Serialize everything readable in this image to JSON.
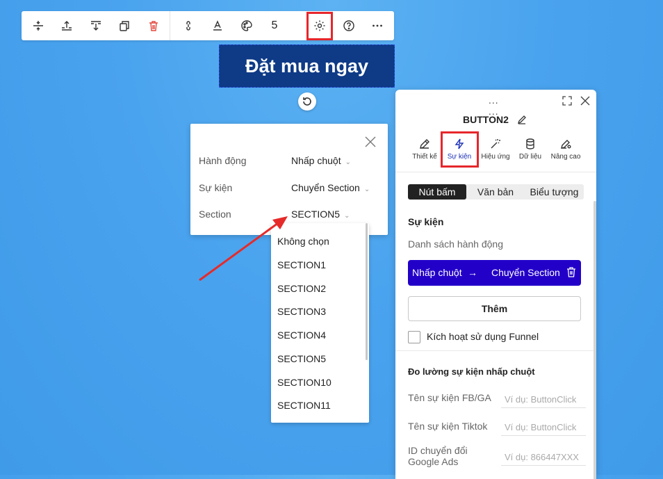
{
  "toolbar": {
    "buttons": [
      {
        "name": "align-center-icon"
      },
      {
        "name": "move-up-icon"
      },
      {
        "name": "move-down-icon"
      },
      {
        "name": "duplicate-icon"
      },
      {
        "name": "delete-icon"
      },
      {
        "name": "link-icon"
      },
      {
        "name": "text-style-icon"
      },
      {
        "name": "palette-icon"
      },
      {
        "name": "settings-icon"
      },
      {
        "name": "help-icon"
      },
      {
        "name": "more-icon"
      }
    ],
    "layer_count": "5",
    "colors": {
      "delete": "#e0463c",
      "highlight": "#e6262b"
    }
  },
  "canvas": {
    "cta_label": "Đặt mua ngay"
  },
  "event_popup": {
    "rows": [
      {
        "label": "Hành động",
        "value": "Nhấp chuột"
      },
      {
        "label": "Sự kiện",
        "value": "Chuyển Section"
      },
      {
        "label": "Section",
        "value": "SECTION5"
      }
    ],
    "dropdown_options": [
      "Không chọn",
      "SECTION1",
      "SECTION2",
      "SECTION3",
      "SECTION4",
      "SECTION5",
      "SECTION10",
      "SECTION11"
    ]
  },
  "panel": {
    "title": "BUTTON2",
    "tabs": [
      {
        "label": "Thiết kế",
        "icon": "edit-icon"
      },
      {
        "label": "Sự kiện",
        "icon": "lightning-icon"
      },
      {
        "label": "Hiệu ứng",
        "icon": "magic-wand-icon"
      },
      {
        "label": "Dữ liệu",
        "icon": "database-icon"
      },
      {
        "label": "Nâng cao",
        "icon": "advanced-settings-icon"
      }
    ],
    "segments": [
      "Nút bấm",
      "Văn bản",
      "Biểu tượng"
    ],
    "event_section_title": "Sự kiện",
    "action_list_label": "Danh sách hành động",
    "action": {
      "trigger": "Nhấp chuột",
      "arrow": "→",
      "target": "Chuyển Section"
    },
    "add_label": "Thêm",
    "funnel_label": "Kích hoạt sử dụng Funnel",
    "tracking_title": "Đo lường sự kiện nhấp chuột",
    "tracking_fields": [
      {
        "label": "Tên sự kiện FB/GA",
        "placeholder": "Ví dụ: ButtonClick"
      },
      {
        "label": "Tên sự kiện Tiktok",
        "placeholder": "Ví dụ: ButtonClick"
      },
      {
        "label": "ID chuyển đổi Google Ads",
        "placeholder": "Ví dụ: 866447XXX"
      }
    ],
    "colors": {
      "action_bg": "#2300c8",
      "active_tab": "#1b2fb5"
    }
  }
}
